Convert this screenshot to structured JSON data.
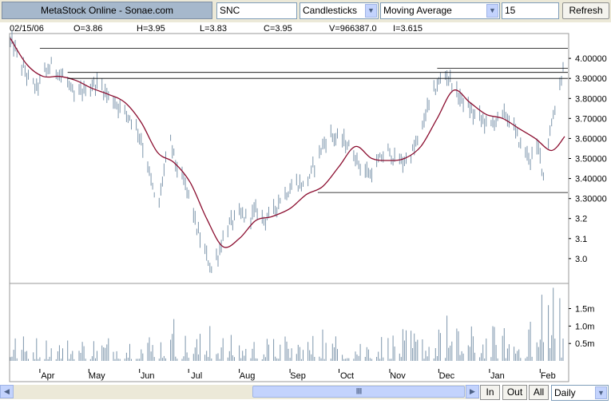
{
  "toolbar": {
    "brand": "MetaStock Online - Sonae.com",
    "symbol": "SNC",
    "chart_style": "Candlesticks",
    "indicator": "Moving Average",
    "period": "15",
    "refresh_label": "Refresh",
    "dropdown_arrow": "▼"
  },
  "info_bar": {
    "date": "02/15/06",
    "open": "O=3.86",
    "high": "H=3.95",
    "low": "L=3.83",
    "close": "C=3.95",
    "volume": "V=966387.0",
    "indicator_value": "I=3.615"
  },
  "bottom_bar": {
    "left_arrow": "◀",
    "right_arrow": "▶",
    "thumb_grip": "||||||",
    "zoom_in_label": "In",
    "zoom_out_label": "Out",
    "all_label": "All",
    "timeframe": "Daily"
  },
  "colors": {
    "price_bars": "#7d96ac",
    "moving_average": "#8b0d2f",
    "volume_bars": "#7d96ac",
    "trend_lines": "#000000"
  },
  "chart_data": [
    {
      "type": "candlestick",
      "panel": "price",
      "x_axis": {
        "type": "date",
        "range": [
          "2005-03-14",
          "2006-02-15"
        ],
        "tick_labels": [
          "Apr",
          "May",
          "Jun",
          "Jul",
          "Aug",
          "Sep",
          "Oct",
          "Nov",
          "Dec",
          "Jan",
          "Feb"
        ],
        "tick_dates": [
          "2005-04-01",
          "2005-05-01",
          "2005-06-01",
          "2005-07-01",
          "2005-08-01",
          "2005-09-01",
          "2005-10-01",
          "2005-11-01",
          "2005-12-01",
          "2006-01-01",
          "2006-02-01"
        ]
      },
      "y_axis": {
        "range": [
          2.88,
          4.12
        ],
        "tick_values": [
          4.0,
          3.9,
          3.8,
          3.7,
          3.6,
          3.5,
          3.4,
          3.3,
          3.2,
          3.1,
          3.0
        ],
        "tick_labels": [
          "4.00000",
          "3.90000",
          "3.80000",
          "3.70000",
          "3.60000",
          "3.50000",
          "3.40000",
          "3.30000",
          "3.2",
          "3.1",
          "3.0"
        ],
        "position": "right"
      },
      "grid": false,
      "price_path": [
        [
          "2005-03-15",
          4.08
        ],
        [
          "2005-03-20",
          3.98
        ],
        [
          "2005-03-25",
          3.9
        ],
        [
          "2005-03-30",
          3.85
        ],
        [
          "2005-04-03",
          3.92
        ],
        [
          "2005-04-08",
          3.96
        ],
        [
          "2005-04-13",
          3.93
        ],
        [
          "2005-04-18",
          3.88
        ],
        [
          "2005-04-22",
          3.8
        ],
        [
          "2005-04-26",
          3.83
        ],
        [
          "2005-05-02",
          3.86
        ],
        [
          "2005-05-07",
          3.88
        ],
        [
          "2005-05-12",
          3.82
        ],
        [
          "2005-05-17",
          3.78
        ],
        [
          "2005-05-22",
          3.74
        ],
        [
          "2005-05-27",
          3.7
        ],
        [
          "2005-06-01",
          3.62
        ],
        [
          "2005-06-05",
          3.5
        ],
        [
          "2005-06-09",
          3.35
        ],
        [
          "2005-06-12",
          3.22
        ],
        [
          "2005-06-16",
          3.45
        ],
        [
          "2005-06-20",
          3.58
        ],
        [
          "2005-06-24",
          3.45
        ],
        [
          "2005-06-28",
          3.38
        ],
        [
          "2005-07-02",
          3.3
        ],
        [
          "2005-07-06",
          3.15
        ],
        [
          "2005-07-10",
          3.05
        ],
        [
          "2005-07-15",
          2.95
        ],
        [
          "2005-07-19",
          3.02
        ],
        [
          "2005-07-23",
          3.13
        ],
        [
          "2005-07-27",
          3.18
        ],
        [
          "2005-08-01",
          3.22
        ],
        [
          "2005-08-06",
          3.2
        ],
        [
          "2005-08-11",
          3.24
        ],
        [
          "2005-08-16",
          3.2
        ],
        [
          "2005-08-21",
          3.22
        ],
        [
          "2005-08-26",
          3.3
        ],
        [
          "2005-08-31",
          3.34
        ],
        [
          "2005-09-05",
          3.38
        ],
        [
          "2005-09-10",
          3.36
        ],
        [
          "2005-09-15",
          3.45
        ],
        [
          "2005-09-20",
          3.55
        ],
        [
          "2005-09-25",
          3.62
        ],
        [
          "2005-09-30",
          3.6
        ],
        [
          "2005-10-05",
          3.58
        ],
        [
          "2005-10-10",
          3.52
        ],
        [
          "2005-10-15",
          3.45
        ],
        [
          "2005-10-20",
          3.42
        ],
        [
          "2005-10-25",
          3.48
        ],
        [
          "2005-10-30",
          3.54
        ],
        [
          "2005-11-04",
          3.5
        ],
        [
          "2005-11-09",
          3.48
        ],
        [
          "2005-11-14",
          3.52
        ],
        [
          "2005-11-19",
          3.6
        ],
        [
          "2005-11-24",
          3.75
        ],
        [
          "2005-11-29",
          3.85
        ],
        [
          "2005-12-04",
          3.92
        ],
        [
          "2005-12-08",
          3.9
        ],
        [
          "2005-12-12",
          3.82
        ],
        [
          "2005-12-17",
          3.78
        ],
        [
          "2005-12-22",
          3.72
        ],
        [
          "2005-12-27",
          3.7
        ],
        [
          "2006-01-01",
          3.66
        ],
        [
          "2006-01-06",
          3.7
        ],
        [
          "2006-01-11",
          3.72
        ],
        [
          "2006-01-16",
          3.65
        ],
        [
          "2006-01-21",
          3.55
        ],
        [
          "2006-01-26",
          3.5
        ],
        [
          "2006-01-31",
          3.55
        ],
        [
          "2006-02-03",
          3.42
        ],
        [
          "2006-02-06",
          3.6
        ],
        [
          "2006-02-10",
          3.75
        ],
        [
          "2006-02-15",
          3.95
        ]
      ],
      "moving_average": {
        "period": 15,
        "points": [
          [
            "2005-03-14",
            4.1
          ],
          [
            "2005-03-24",
            3.97
          ],
          [
            "2005-04-03",
            3.91
          ],
          [
            "2005-04-13",
            3.91
          ],
          [
            "2005-04-23",
            3.89
          ],
          [
            "2005-05-03",
            3.85
          ],
          [
            "2005-05-13",
            3.82
          ],
          [
            "2005-05-23",
            3.78
          ],
          [
            "2005-06-02",
            3.68
          ],
          [
            "2005-06-12",
            3.53
          ],
          [
            "2005-06-22",
            3.48
          ],
          [
            "2005-07-02",
            3.38
          ],
          [
            "2005-07-12",
            3.2
          ],
          [
            "2005-07-22",
            3.06
          ],
          [
            "2005-08-01",
            3.1
          ],
          [
            "2005-08-11",
            3.19
          ],
          [
            "2005-08-21",
            3.21
          ],
          [
            "2005-09-01",
            3.25
          ],
          [
            "2005-09-11",
            3.32
          ],
          [
            "2005-09-21",
            3.36
          ],
          [
            "2005-10-01",
            3.46
          ],
          [
            "2005-10-11",
            3.56
          ],
          [
            "2005-10-21",
            3.5
          ],
          [
            "2005-10-31",
            3.49
          ],
          [
            "2005-11-10",
            3.5
          ],
          [
            "2005-11-20",
            3.56
          ],
          [
            "2005-11-30",
            3.7
          ],
          [
            "2005-12-10",
            3.84
          ],
          [
            "2005-12-20",
            3.78
          ],
          [
            "2005-12-30",
            3.72
          ],
          [
            "2006-01-09",
            3.7
          ],
          [
            "2006-01-19",
            3.65
          ],
          [
            "2006-01-29",
            3.6
          ],
          [
            "2006-02-08",
            3.54
          ],
          [
            "2006-02-16",
            3.61
          ]
        ]
      },
      "trend_lines": [
        {
          "y": 4.05,
          "from": "2005-04-01",
          "to": "2006-02-21"
        },
        {
          "y": 3.95,
          "from": "2005-11-30",
          "to": "2006-02-21"
        },
        {
          "y": 3.93,
          "from": "2005-04-18",
          "to": "2006-02-21"
        },
        {
          "y": 3.9,
          "from": "2005-04-18",
          "to": "2006-02-21"
        },
        {
          "y": 3.33,
          "from": "2005-09-18",
          "to": "2006-02-21"
        }
      ]
    },
    {
      "type": "bar",
      "panel": "volume",
      "y_axis": {
        "range": [
          0,
          2.2
        ],
        "unit": "millions",
        "tick_values": [
          1.5,
          1.0,
          0.5
        ],
        "tick_labels": [
          "1.5m",
          "1.0m",
          "0.5m"
        ],
        "position": "right"
      },
      "grid": false,
      "volume_profile_millions": [
        [
          "2005-03-14",
          0.35
        ],
        [
          "2005-04-15",
          0.3
        ],
        [
          "2005-05-15",
          0.35
        ],
        [
          "2005-06-15",
          0.4
        ],
        [
          "2005-07-15",
          0.35
        ],
        [
          "2005-08-15",
          0.3
        ],
        [
          "2005-09-15",
          0.35
        ],
        [
          "2005-10-15",
          0.35
        ],
        [
          "2005-11-15",
          0.4
        ],
        [
          "2005-12-15",
          0.45
        ],
        [
          "2006-01-15",
          0.45
        ],
        [
          "2006-02-15",
          0.6
        ]
      ],
      "notable_spikes_millions": [
        [
          "2005-06-22",
          1.2
        ],
        [
          "2005-07-03",
          1.6
        ],
        [
          "2005-07-14",
          1.0
        ],
        [
          "2005-09-21",
          0.9
        ],
        [
          "2005-12-02",
          0.8
        ],
        [
          "2005-12-06",
          1.3
        ],
        [
          "2006-01-25",
          0.9
        ],
        [
          "2006-02-02",
          1.9
        ],
        [
          "2006-02-06",
          1.6
        ],
        [
          "2006-02-09",
          2.1
        ],
        [
          "2006-02-13",
          1.8
        ]
      ]
    }
  ]
}
